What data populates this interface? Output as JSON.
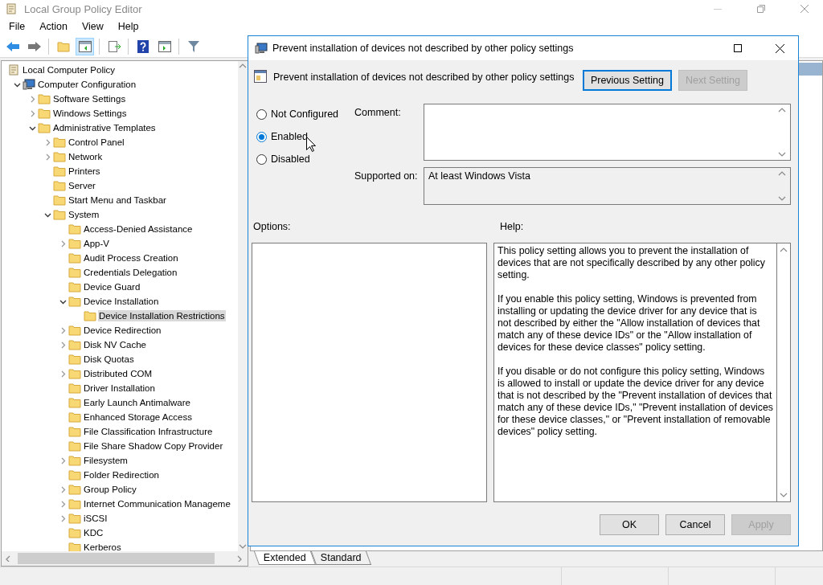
{
  "window": {
    "title": "Local Group Policy Editor"
  },
  "menu": [
    "File",
    "Action",
    "View",
    "Help"
  ],
  "tree": [
    {
      "label": "Local Computer Policy",
      "kind": "root",
      "selected": false,
      "children": [
        {
          "label": "Computer Configuration",
          "kind": "computer",
          "selected": false,
          "expanded": true,
          "children": [
            {
              "label": "Software Settings",
              "kind": "folder",
              "selected": false,
              "expanded": false
            },
            {
              "label": "Windows Settings",
              "kind": "folder",
              "selected": false,
              "expanded": false
            },
            {
              "label": "Administrative Templates",
              "kind": "folder",
              "selected": false,
              "expanded": true,
              "children": [
                {
                  "label": "Control Panel",
                  "kind": "folder",
                  "selected": false,
                  "expanded": false
                },
                {
                  "label": "Network",
                  "kind": "folder",
                  "selected": false,
                  "expanded": false
                },
                {
                  "label": "Printers",
                  "kind": "folder",
                  "selected": false
                },
                {
                  "label": "Server",
                  "kind": "folder",
                  "selected": false
                },
                {
                  "label": "Start Menu and Taskbar",
                  "kind": "folder",
                  "selected": false
                },
                {
                  "label": "System",
                  "kind": "folder",
                  "selected": false,
                  "expanded": true,
                  "children": [
                    {
                      "label": "Access-Denied Assistance",
                      "kind": "folder",
                      "selected": false
                    },
                    {
                      "label": "App-V",
                      "kind": "folder",
                      "selected": false,
                      "expanded": false
                    },
                    {
                      "label": "Audit Process Creation",
                      "kind": "folder",
                      "selected": false
                    },
                    {
                      "label": "Credentials Delegation",
                      "kind": "folder",
                      "selected": false
                    },
                    {
                      "label": "Device Guard",
                      "kind": "folder",
                      "selected": false
                    },
                    {
                      "label": "Device Installation",
                      "kind": "folder",
                      "selected": false,
                      "expanded": true,
                      "children": [
                        {
                          "label": "Device Installation Restrictions",
                          "kind": "folder",
                          "selected": true
                        }
                      ]
                    },
                    {
                      "label": "Device Redirection",
                      "kind": "folder",
                      "selected": false,
                      "expanded": false
                    },
                    {
                      "label": "Disk NV Cache",
                      "kind": "folder",
                      "selected": false,
                      "expanded": false
                    },
                    {
                      "label": "Disk Quotas",
                      "kind": "folder",
                      "selected": false
                    },
                    {
                      "label": "Distributed COM",
                      "kind": "folder",
                      "selected": false,
                      "expanded": false
                    },
                    {
                      "label": "Driver Installation",
                      "kind": "folder",
                      "selected": false
                    },
                    {
                      "label": "Early Launch Antimalware",
                      "kind": "folder",
                      "selected": false
                    },
                    {
                      "label": "Enhanced Storage Access",
                      "kind": "folder",
                      "selected": false
                    },
                    {
                      "label": "File Classification Infrastructure",
                      "kind": "folder",
                      "selected": false
                    },
                    {
                      "label": "File Share Shadow Copy Provider",
                      "kind": "folder",
                      "selected": false
                    },
                    {
                      "label": "Filesystem",
                      "kind": "folder",
                      "selected": false,
                      "expanded": false
                    },
                    {
                      "label": "Folder Redirection",
                      "kind": "folder",
                      "selected": false
                    },
                    {
                      "label": "Group Policy",
                      "kind": "folder",
                      "selected": false,
                      "expanded": false
                    },
                    {
                      "label": "Internet Communication Manageme",
                      "kind": "folder",
                      "selected": false,
                      "expanded": false
                    },
                    {
                      "label": "iSCSI",
                      "kind": "folder",
                      "selected": false,
                      "expanded": false
                    },
                    {
                      "label": "KDC",
                      "kind": "folder",
                      "selected": false
                    },
                    {
                      "label": "Kerberos",
                      "kind": "folder",
                      "selected": false
                    }
                  ]
                }
              ]
            }
          ]
        }
      ]
    }
  ],
  "view_tabs": [
    {
      "label": "Extended",
      "selected": true
    },
    {
      "label": "Standard",
      "selected": false
    }
  ],
  "dialog": {
    "title": "Prevent installation of devices not described by other policy settings",
    "setting_name": "Prevent installation of devices not described by other policy settings",
    "nav_buttons": [
      {
        "label": "Previous Setting",
        "disabled": false,
        "focused": true
      },
      {
        "label": "Next Setting",
        "disabled": true,
        "focused": false
      }
    ],
    "options": [
      {
        "label": "Not Configured",
        "selected": false
      },
      {
        "label": "Enabled",
        "selected": true
      },
      {
        "label": "Disabled",
        "selected": false
      }
    ],
    "comment_label": "Comment:",
    "supported_label": "Supported on:",
    "supported_value": "At least Windows Vista",
    "options_label": "Options:",
    "help_label": "Help:",
    "help": [
      "This policy setting allows you to prevent the installation of devices that are not specifically described by any other policy setting.",
      "If you enable this policy setting, Windows is prevented from installing or updating the device driver for any device that is not described by either the \"Allow installation of devices that match any of these device IDs\" or the \"Allow installation of devices for these device classes\" policy setting.",
      "If you disable or do not configure this policy setting, Windows is allowed to install or update the device driver for any device that is not described by the \"Prevent installation of devices that match any of these device IDs,\" \"Prevent installation of devices for these device classes,\" or \"Prevent installation of removable devices\" policy setting."
    ],
    "buttons": [
      {
        "label": "OK",
        "disabled": false
      },
      {
        "label": "Cancel",
        "disabled": false
      },
      {
        "label": "Apply",
        "disabled": true
      }
    ]
  }
}
